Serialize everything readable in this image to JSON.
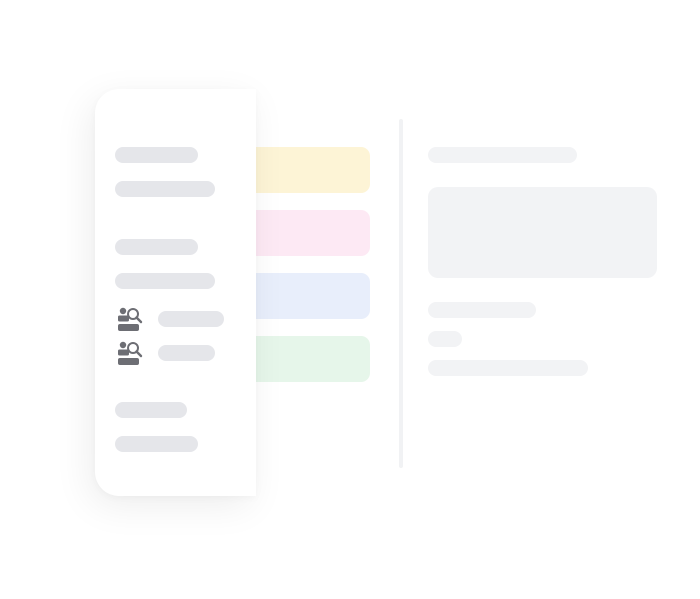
{
  "colors": {
    "card_yellow": "#fdf4d6",
    "card_pink": "#fde9f4",
    "card_blue": "#e8eefb",
    "card_green": "#e6f6ea",
    "placeholder": "#e5e6ea",
    "icon": "#6d6e74"
  },
  "panel": {
    "icons": [
      "user-search-icon",
      "user-search-icon"
    ]
  }
}
